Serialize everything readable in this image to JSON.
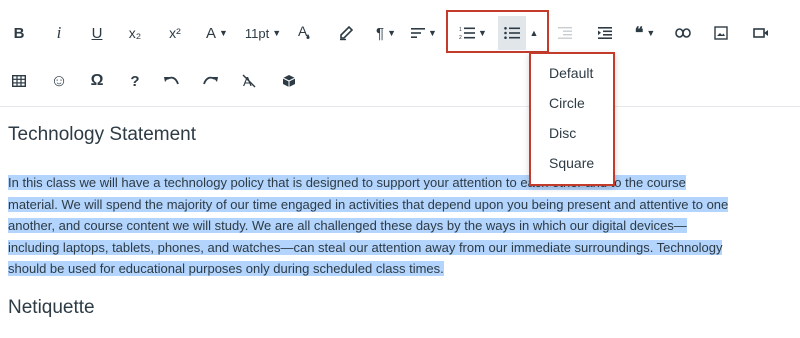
{
  "toolbar": {
    "bold_label": "B",
    "italic_label": "i",
    "underline_label": "U",
    "subscript_label": "x₂",
    "superscript_label": "x²",
    "font_color_label": "A",
    "font_size_label": "11pt",
    "quote_label": "66",
    "help_label": "?",
    "omega_label": "Ω"
  },
  "list_menu": {
    "items": [
      "Default",
      "Circle",
      "Disc",
      "Square"
    ]
  },
  "content": {
    "heading1": "Technology Statement",
    "paragraph_lines": [
      "In this class we will have a technology policy that is designed to support your attention to each other and to the course",
      "material. We will spend the majority of our time engaged in activities that depend upon you being present and attentive to one",
      "another, and course content we will study. We are all challenged these days by the ways in which our digital devices—",
      "including laptops, tablets, phones, and watches—can steal our attention away from our immediate surroundings. Technology",
      "should be used for educational purposes only during scheduled class times."
    ],
    "heading2": "Netiquette"
  },
  "colors": {
    "accent_red": "#c23b2b",
    "selection": "#b3d4fc",
    "text": "#2d3b45"
  }
}
